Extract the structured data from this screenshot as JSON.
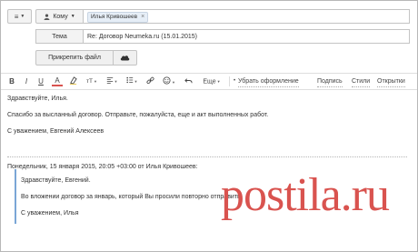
{
  "compose": {
    "to_label": "Кому",
    "recipient_chip": "Илья Кривошеев",
    "subject_label": "Тема",
    "subject_value": "Re: Договор Neumeka.ru (15.01.2015)",
    "attach_label": "Прикрепить файл"
  },
  "toolbar": {
    "bold": "B",
    "italic": "I",
    "underline": "U",
    "color": "A",
    "font_size": "тТ",
    "more_label": "Еще",
    "remove_format": "Убрать оформление",
    "signature": "Подпись",
    "styles": "Стили",
    "postcards": "Открытки"
  },
  "message": {
    "greeting": "Здравствуйте, Илья.",
    "thanks": "Спасибо за высланный договор. Отправьте, пожалуйста, еще и акт выполненных работ.",
    "sign": "С уважением, Евгений Алексеев",
    "quote_header": "Понедельник, 15 января 2015, 20:05 +03:00 от Илья Кривошеев:",
    "quote_greeting": "Здравствуйте, Евгений.",
    "quote_body": "Во вложении договор за январь, который Вы просили повторно отправить.",
    "quote_sign": "С уважением, Илья"
  },
  "watermark": {
    "text": "postila.ru"
  },
  "colors": {
    "watermark": "#d9534f",
    "quote_bar": "#7aa6d6"
  }
}
